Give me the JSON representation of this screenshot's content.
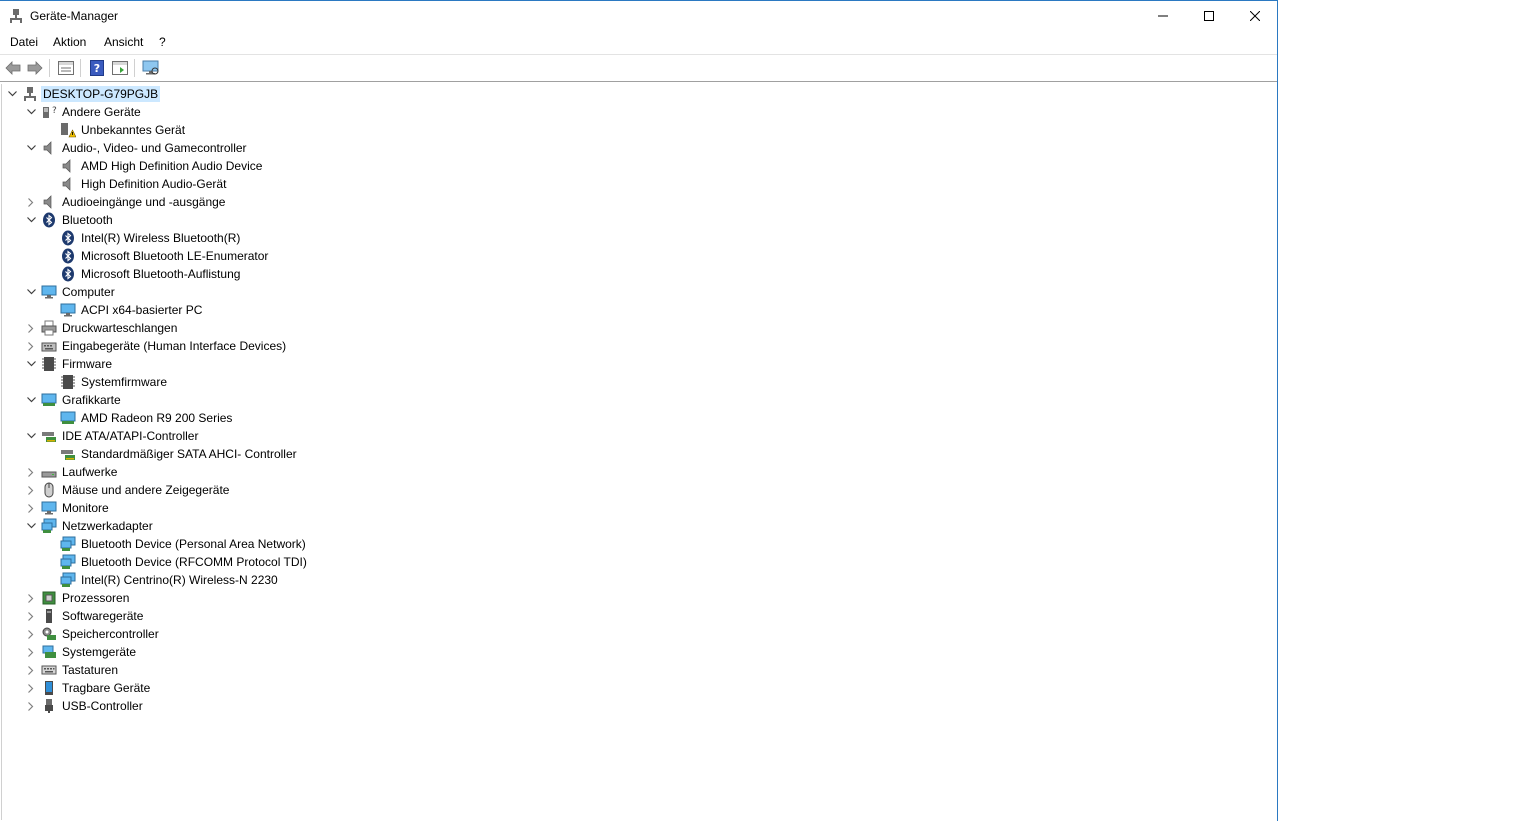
{
  "window": {
    "title": "Geräte-Manager"
  },
  "menu": [
    "Datei",
    "Aktion",
    "Ansicht",
    "?"
  ],
  "tree": {
    "root": "DESKTOP-G79PGJB",
    "nodes": [
      {
        "label": "Andere Geräte",
        "level": 1,
        "state": "expanded",
        "icon": "unknown-device-icon"
      },
      {
        "label": "Unbekanntes Gerät",
        "level": 2,
        "state": "leaf",
        "icon": "warning-device-icon"
      },
      {
        "label": "Audio-, Video- und Gamecontroller",
        "level": 1,
        "state": "expanded",
        "icon": "speaker-icon"
      },
      {
        "label": "AMD High Definition Audio Device",
        "level": 2,
        "state": "leaf",
        "icon": "speaker-icon"
      },
      {
        "label": "High Definition Audio-Gerät",
        "level": 2,
        "state": "leaf",
        "icon": "speaker-icon"
      },
      {
        "label": "Audioeingänge und -ausgänge",
        "level": 1,
        "state": "collapsed",
        "icon": "speaker-icon"
      },
      {
        "label": "Bluetooth",
        "level": 1,
        "state": "expanded",
        "icon": "bluetooth-icon"
      },
      {
        "label": "Intel(R) Wireless Bluetooth(R)",
        "level": 2,
        "state": "leaf",
        "icon": "bluetooth-icon"
      },
      {
        "label": "Microsoft Bluetooth LE-Enumerator",
        "level": 2,
        "state": "leaf",
        "icon": "bluetooth-icon"
      },
      {
        "label": "Microsoft Bluetooth-Auflistung",
        "level": 2,
        "state": "leaf",
        "icon": "bluetooth-icon"
      },
      {
        "label": "Computer",
        "level": 1,
        "state": "expanded",
        "icon": "monitor-icon"
      },
      {
        "label": "ACPI x64-basierter PC",
        "level": 2,
        "state": "leaf",
        "icon": "monitor-icon"
      },
      {
        "label": "Druckwarteschlangen",
        "level": 1,
        "state": "collapsed",
        "icon": "printer-icon"
      },
      {
        "label": "Eingabegeräte (Human Interface Devices)",
        "level": 1,
        "state": "collapsed",
        "icon": "hid-icon"
      },
      {
        "label": "Firmware",
        "level": 1,
        "state": "expanded",
        "icon": "chip-icon"
      },
      {
        "label": "Systemfirmware",
        "level": 2,
        "state": "leaf",
        "icon": "chip-icon"
      },
      {
        "label": "Grafikkarte",
        "level": 1,
        "state": "expanded",
        "icon": "display-adapter-icon"
      },
      {
        "label": "AMD Radeon R9 200 Series",
        "level": 2,
        "state": "leaf",
        "icon": "display-adapter-icon"
      },
      {
        "label": "IDE ATA/ATAPI-Controller",
        "level": 1,
        "state": "expanded",
        "icon": "controller-icon"
      },
      {
        "label": "Standardmäßiger SATA AHCI- Controller",
        "level": 2,
        "state": "leaf",
        "icon": "controller-icon"
      },
      {
        "label": "Laufwerke",
        "level": 1,
        "state": "collapsed",
        "icon": "drive-icon"
      },
      {
        "label": "Mäuse und andere Zeigegeräte",
        "level": 1,
        "state": "collapsed",
        "icon": "mouse-icon"
      },
      {
        "label": "Monitore",
        "level": 1,
        "state": "collapsed",
        "icon": "monitor-icon"
      },
      {
        "label": "Netzwerkadapter",
        "level": 1,
        "state": "expanded",
        "icon": "network-icon"
      },
      {
        "label": "Bluetooth Device (Personal Area Network)",
        "level": 2,
        "state": "leaf",
        "icon": "network-icon"
      },
      {
        "label": "Bluetooth Device (RFCOMM Protocol TDI)",
        "level": 2,
        "state": "leaf",
        "icon": "network-icon"
      },
      {
        "label": "Intel(R) Centrino(R) Wireless-N 2230",
        "level": 2,
        "state": "leaf",
        "icon": "network-icon"
      },
      {
        "label": "Prozessoren",
        "level": 1,
        "state": "collapsed",
        "icon": "processor-icon"
      },
      {
        "label": "Softwaregeräte",
        "level": 1,
        "state": "collapsed",
        "icon": "software-device-icon"
      },
      {
        "label": "Speichercontroller",
        "level": 1,
        "state": "collapsed",
        "icon": "storage-controller-icon"
      },
      {
        "label": "Systemgeräte",
        "level": 1,
        "state": "collapsed",
        "icon": "system-device-icon"
      },
      {
        "label": "Tastaturen",
        "level": 1,
        "state": "collapsed",
        "icon": "keyboard-icon"
      },
      {
        "label": "Tragbare Geräte",
        "level": 1,
        "state": "collapsed",
        "icon": "portable-device-icon"
      },
      {
        "label": "USB-Controller",
        "level": 1,
        "state": "collapsed",
        "icon": "usb-icon"
      }
    ]
  }
}
